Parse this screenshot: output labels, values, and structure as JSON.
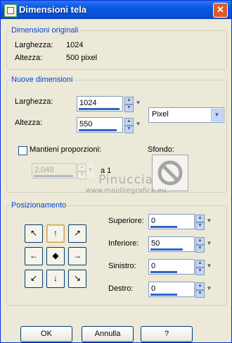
{
  "window": {
    "title": "Dimensioni tela",
    "close_symbol": "✕"
  },
  "original": {
    "legend": "Dimensioni originali",
    "width_label": "Larghezza:",
    "width_value": "1024",
    "height_label": "Altezza:",
    "height_value": "500 pixel"
  },
  "new": {
    "legend": "Nuove dimensioni",
    "width_label": "Larghezza:",
    "width_value": "1024",
    "height_label": "Altezza:",
    "height_value": "550",
    "unit_selected": "Pixel",
    "proportions_label": "Mantieni proporzioni:",
    "proportions_checked": false,
    "ratio_value": "2,048",
    "ratio_suffix": "a 1",
    "background_label": "Sfondo:"
  },
  "position": {
    "legend": "Posizionamento",
    "anchors": [
      {
        "name": "anchor-top-left-button",
        "glyph": "↖"
      },
      {
        "name": "anchor-top-button",
        "glyph": "↑"
      },
      {
        "name": "anchor-top-right-button",
        "glyph": "↗"
      },
      {
        "name": "anchor-left-button",
        "glyph": "←"
      },
      {
        "name": "anchor-center-button",
        "glyph": "◆"
      },
      {
        "name": "anchor-right-button",
        "glyph": "→"
      },
      {
        "name": "anchor-bottom-left-button",
        "glyph": "↙"
      },
      {
        "name": "anchor-bottom-button",
        "glyph": "↓"
      },
      {
        "name": "anchor-bottom-right-button",
        "glyph": "↘"
      }
    ],
    "selected_anchor": "anchor-top-button",
    "top_label": "Superiore:",
    "top_value": "0",
    "bottom_label": "Inferiore:",
    "bottom_value": "50",
    "left_label": "Sinistro:",
    "left_value": "0",
    "right_label": "Destro:",
    "right_value": "0"
  },
  "watermark": {
    "line1": "Pinuccia",
    "line2": "www.maidiregrafica.eu"
  },
  "buttons": {
    "ok": "OK",
    "cancel": "Annulla",
    "help": "?"
  }
}
